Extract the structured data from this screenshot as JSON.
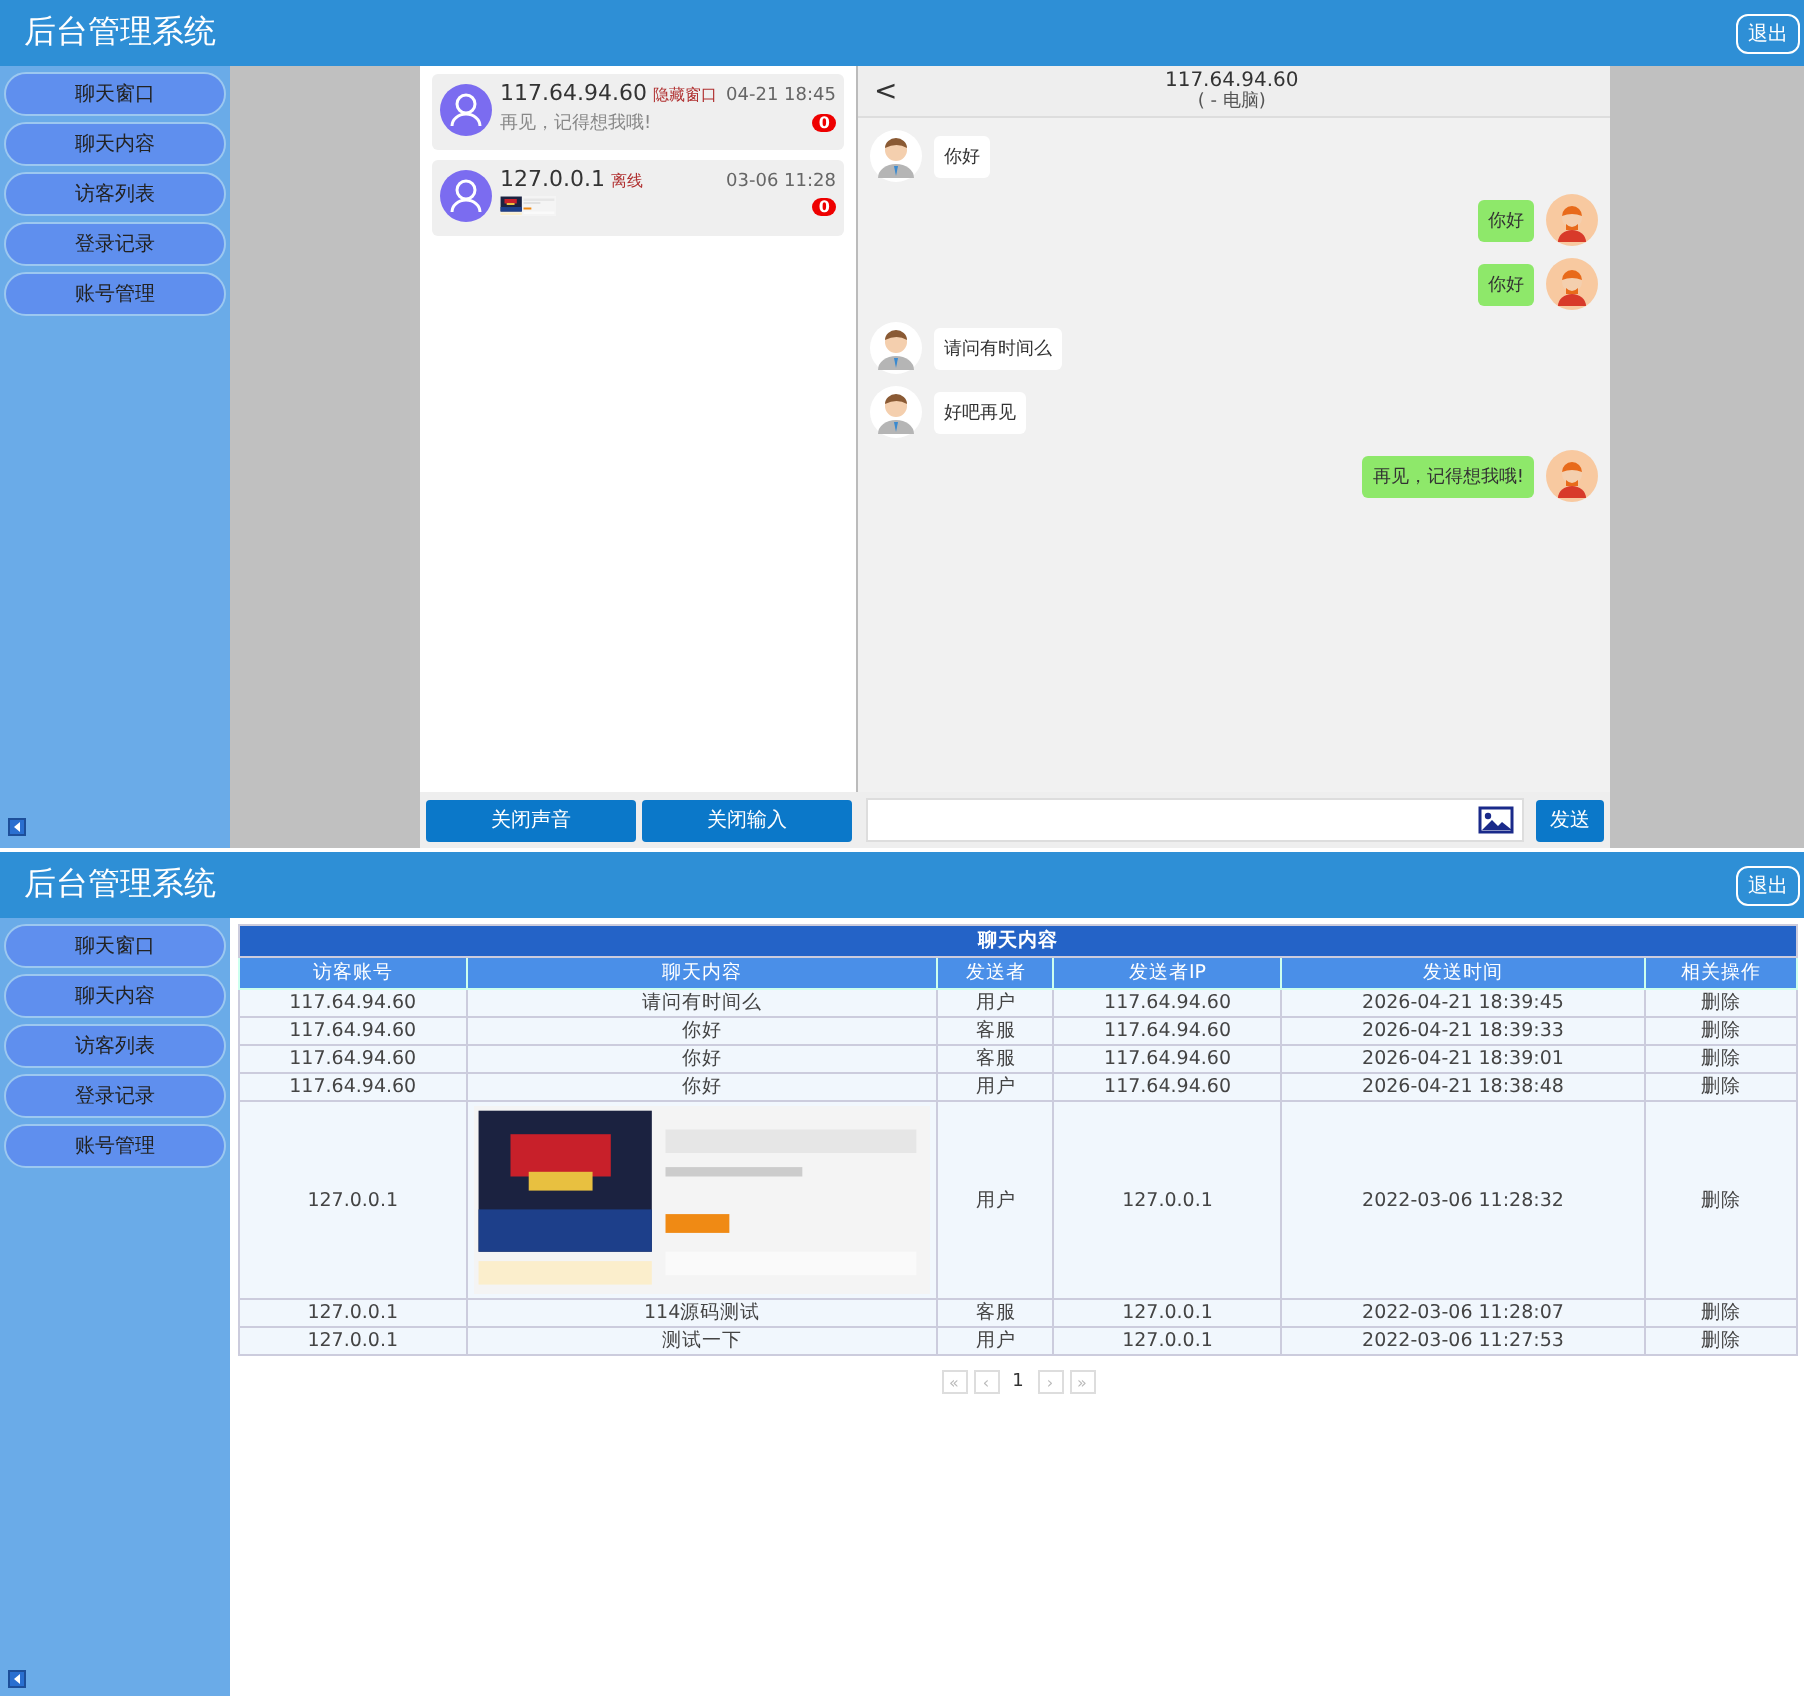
{
  "chat_screen": {
    "header": {
      "title": "后台管理系统",
      "logout": "退出"
    },
    "sidebar": {
      "items": [
        "聊天窗口",
        "聊天内容",
        "访客列表",
        "登录记录",
        "账号管理"
      ]
    },
    "contacts": [
      {
        "ip": "117.64.94.60",
        "tag": "隐藏窗口",
        "time": "04-21 18:45",
        "preview": {
          "kind": "text",
          "text": "再见，记得想我哦!"
        },
        "unread": "0"
      },
      {
        "ip": "127.0.0.1",
        "tag": "离线",
        "time": "03-06 11:28",
        "unread": "0"
      }
    ],
    "chat": {
      "title": "117.64.94.60",
      "subtitle": "( - 电脑)",
      "back": "<",
      "messages": [
        {
          "kind": "visitor",
          "text": "你好"
        },
        {
          "kind": "agent",
          "text": "你好"
        },
        {
          "kind": "agent",
          "text": "你好"
        },
        {
          "kind": "visitor",
          "text": "请问有时间么"
        },
        {
          "kind": "visitor",
          "text": "好吧再见"
        },
        {
          "kind": "agent",
          "text": "再见，记得想我哦!"
        }
      ]
    },
    "bottom": {
      "buttons": [
        "关闭声音",
        "关闭输入"
      ],
      "send": "发送"
    }
  },
  "records_screen": {
    "header": {
      "title": "后台管理系统",
      "logout": "退出"
    },
    "sidebar": {
      "items": [
        "聊天窗口",
        "聊天内容",
        "访客列表",
        "登录记录",
        "账号管理"
      ]
    },
    "table": {
      "title": "聊天内容",
      "columns": [
        "访客账号",
        "聊天内容",
        "发送者",
        "发送者IP",
        "发送时间",
        "相关操作"
      ],
      "rows": [
        {
          "account": "117.64.94.60",
          "content": {
            "kind": "text",
            "text": "请问有时间么"
          },
          "sender": "用户",
          "ip": "117.64.94.60",
          "time": "2026-04-21 18:39:45",
          "action": "删除"
        },
        {
          "account": "117.64.94.60",
          "content": {
            "kind": "text",
            "text": "你好"
          },
          "sender": "客服",
          "ip": "117.64.94.60",
          "time": "2026-04-21 18:39:33",
          "action": "删除"
        },
        {
          "account": "117.64.94.60",
          "content": {
            "kind": "text",
            "text": "你好"
          },
          "sender": "客服",
          "ip": "117.64.94.60",
          "time": "2026-04-21 18:39:01",
          "action": "删除"
        },
        {
          "account": "117.64.94.60",
          "content": {
            "kind": "text",
            "text": "你好"
          },
          "sender": "用户",
          "ip": "117.64.94.60",
          "time": "2026-04-21 18:38:48",
          "action": "删除"
        },
        {
          "account": "127.0.0.1",
          "sender": "用户",
          "ip": "127.0.0.1",
          "time": "2022-03-06 11:28:32",
          "action": "删除"
        },
        {
          "account": "127.0.0.1",
          "content": {
            "kind": "text",
            "text": "114源码测试"
          },
          "sender": "客服",
          "ip": "127.0.0.1",
          "time": "2022-03-06 11:28:07",
          "action": "删除"
        },
        {
          "account": "127.0.0.1",
          "content": {
            "kind": "text",
            "text": "测试一下"
          },
          "sender": "用户",
          "ip": "127.0.0.1",
          "time": "2022-03-06 11:27:53",
          "action": "删除"
        }
      ]
    },
    "pagination": [
      {
        "label": "«",
        "selected": false
      },
      {
        "label": "‹",
        "selected": false
      },
      {
        "label": "1",
        "selected": true
      },
      {
        "label": "›",
        "selected": false
      },
      {
        "label": "»",
        "selected": false
      }
    ]
  }
}
